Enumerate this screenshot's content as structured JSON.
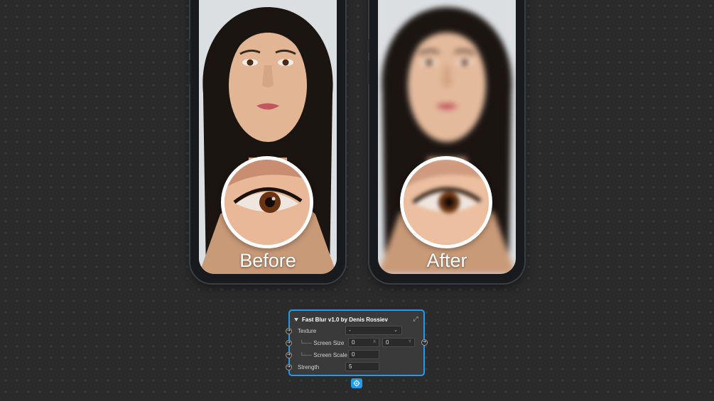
{
  "comparison": {
    "before_label": "Before",
    "after_label": "After"
  },
  "node": {
    "title": "Fast Blur v1.0 by Denis Rossiev",
    "texture": {
      "label": "Texture",
      "value": "-"
    },
    "screen_size": {
      "label": "Screen Size",
      "tree": "└──",
      "x": "0",
      "x_suffix": "X",
      "y": "0",
      "y_suffix": "Y"
    },
    "screen_scale": {
      "label": "Screen Scale",
      "tree": "└──",
      "value": "0"
    },
    "strength": {
      "label": "Strength",
      "value": "5"
    }
  },
  "colors": {
    "accent": "#1f9bf0",
    "background": "#2b2b2b",
    "panel": "#3a3a3b"
  },
  "icons": [
    "expand-icon",
    "settings-icon",
    "chevron-down-icon",
    "port-arrow-icon"
  ]
}
